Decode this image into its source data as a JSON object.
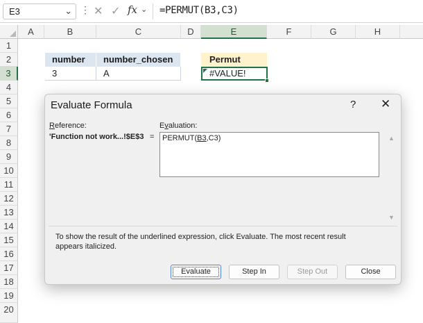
{
  "formula_bar": {
    "name_box": "E3",
    "fx_label": "fx",
    "formula": "=PERMUT(B3,C3)"
  },
  "grid": {
    "columns": [
      "A",
      "B",
      "C",
      "D",
      "E",
      "F",
      "G",
      "H"
    ],
    "rows": [
      "1",
      "2",
      "3",
      "4",
      "5",
      "6",
      "7",
      "8",
      "9",
      "10",
      "11",
      "12",
      "13",
      "14",
      "15",
      "16",
      "17",
      "18",
      "19",
      "20"
    ],
    "selected_column": "E",
    "selected_row": "3",
    "cells": {
      "B2": "number",
      "C2": "number_chosen",
      "B3": "3",
      "C3": "A",
      "E2": "Permut",
      "E3": "#VALUE!"
    }
  },
  "dialog": {
    "title": "Evaluate Formula",
    "help": "?",
    "close": "✕",
    "reference_label_prefix": "",
    "reference_label_u": "R",
    "reference_label_rest": "eference:",
    "reference_value": "'Function not work...!$E$3",
    "equals": "=",
    "evaluation_label_u": "v",
    "evaluation_label_pre": "E",
    "evaluation_label_rest": "aluation:",
    "evaluation_pre": "PERMUT(",
    "evaluation_underlined": "B3",
    "evaluation_post": ",C3)",
    "hint": "To show the result of the underlined expression, click Evaluate.  The most recent result appears italicized.",
    "buttons": {
      "evaluate": "Evaluate",
      "step_in": "Step In",
      "step_out": "Step Out",
      "close": "Close"
    }
  },
  "colors": {
    "excel_green": "#217346",
    "table_header": "#dce6f1",
    "permut_header": "#fff2cc"
  }
}
